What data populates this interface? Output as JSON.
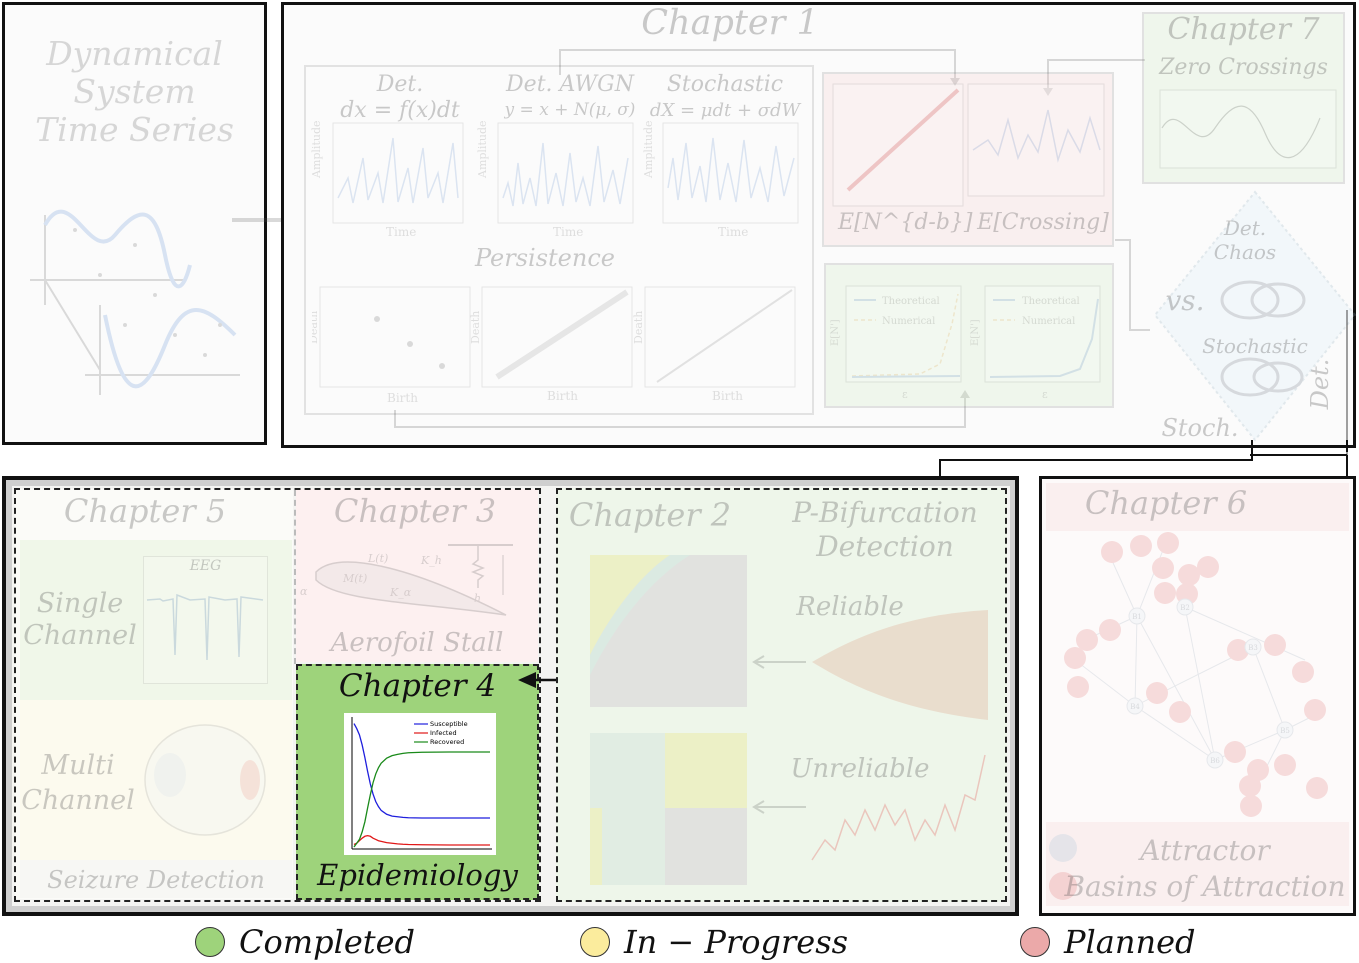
{
  "top": {
    "left_panel": {
      "title_lines": [
        "Dynamical",
        "System",
        "Time Series"
      ]
    },
    "chapter1": {
      "title": "Chapter 1",
      "col_heads": [
        {
          "line1": "Det.",
          "line2": "dx = f(x)dt"
        },
        {
          "line1": "Det. AWGN",
          "line2": "y = x + N(μ, σ)"
        },
        {
          "line1": "Stochastic",
          "line2": "dX = μdt + σdW"
        }
      ],
      "axis_amplitude": "Amplitude",
      "axis_time": "Time",
      "persistence_label": "Persistence",
      "axis_death": "Death",
      "axis_birth": "Birth",
      "expect_labels": [
        "E[N^{d-b}]",
        "E[Crossing]"
      ],
      "legend_theoretical": "Theoretical",
      "legend_numerical": "Numerical",
      "axis_en": "E[N']",
      "axis_eps": "ε"
    },
    "chapter7": {
      "title": "Chapter 7",
      "subtitle": "Zero Crossings"
    },
    "diamond": {
      "top1": "Det.",
      "top2": "Chaos",
      "vs": "vs.",
      "mid": "Stochastic",
      "left": "Stoch.",
      "right": "Det."
    }
  },
  "bottom": {
    "chapter5": {
      "title": "Chapter 5",
      "single": [
        "Single",
        "Channel"
      ],
      "eeg": "EEG",
      "multi": [
        "Multi",
        "Channel"
      ],
      "footer": "Seizure Detection"
    },
    "chapter3": {
      "title": "Chapter 3",
      "footer": "Aerofoil Stall",
      "labels": [
        "L(t)",
        "M(t)",
        "K_h",
        "h",
        "α",
        "K_α"
      ]
    },
    "chapter4": {
      "title": "Chapter 4",
      "footer": "Epidemiology",
      "chart_data": {
        "type": "line",
        "x": [
          0,
          1,
          2,
          3,
          4,
          5,
          6,
          7,
          8,
          9,
          10,
          12,
          14,
          16,
          18,
          20,
          25,
          30,
          35,
          40,
          45,
          50
        ],
        "series": [
          {
            "name": "Susceptible",
            "color": "#1f1fdd",
            "values": [
              0.98,
              0.94,
              0.89,
              0.81,
              0.71,
              0.6,
              0.5,
              0.42,
              0.36,
              0.32,
              0.29,
              0.26,
              0.245,
              0.24,
              0.235,
              0.232,
              0.23,
              0.23,
              0.23,
              0.23,
              0.23,
              0.23
            ]
          },
          {
            "name": "Infected",
            "color": "#e01818",
            "values": [
              0.02,
              0.03,
              0.05,
              0.07,
              0.085,
              0.09,
              0.085,
              0.07,
              0.06,
              0.05,
              0.045,
              0.035,
              0.03,
              0.025,
              0.022,
              0.02,
              0.018,
              0.017,
              0.016,
              0.016,
              0.016,
              0.016
            ]
          },
          {
            "name": "Recovered",
            "color": "#1a8a1a",
            "values": [
              0.0,
              0.03,
              0.06,
              0.12,
              0.2,
              0.31,
              0.415,
              0.51,
              0.58,
              0.63,
              0.665,
              0.705,
              0.725,
              0.735,
              0.743,
              0.748,
              0.752,
              0.753,
              0.754,
              0.754,
              0.754,
              0.754
            ]
          }
        ],
        "xlim": [
          0,
          50
        ],
        "ylim": [
          0,
          1
        ],
        "legend_position": "top-right",
        "grid": false
      }
    },
    "chapter2": {
      "title": "Chapter 2",
      "pbif": [
        "P-Bifurcation",
        "Detection"
      ],
      "reliable": "Reliable",
      "unreliable": "Unreliable"
    },
    "chapter6": {
      "title": "Chapter 6",
      "footer": [
        "Attractor",
        "Basins of Attraction"
      ],
      "node_labels": [
        "B1",
        "B2",
        "B3",
        "B4",
        "B5",
        "B6"
      ]
    }
  },
  "legend": [
    {
      "label": "Completed",
      "color": "#9ed37b"
    },
    {
      "label": "In − Progress",
      "color": "#fbec9d"
    },
    {
      "label": "Planned",
      "color": "#eba9a9"
    }
  ],
  "colors": {
    "completed": "#9ed37b",
    "inprogress": "#fdf4cc",
    "planned": "#f3c8c8",
    "green_tint": "#e9f5e2",
    "pink_tint": "#fbe7e7",
    "yellow_tint": "#fdf7dc"
  }
}
